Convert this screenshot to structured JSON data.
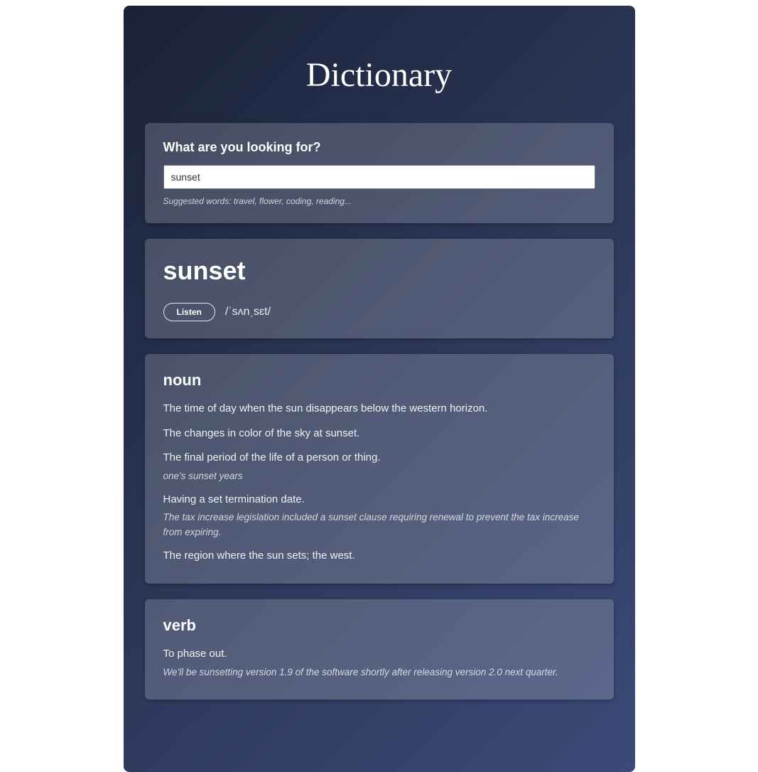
{
  "title": "Dictionary",
  "search": {
    "label": "What are you looking for?",
    "value": "sunset",
    "suggested": "Suggested words: travel, flower, coding, reading..."
  },
  "word": {
    "text": "sunset",
    "listen_label": "Listen",
    "pronunciation": "/ˈsʌnˌsɛt/"
  },
  "entries": [
    {
      "pos": "noun",
      "definitions": [
        {
          "text": "The time of day when the sun disappears below the western horizon.",
          "example": ""
        },
        {
          "text": "The changes in color of the sky at sunset.",
          "example": ""
        },
        {
          "text": "The final period of the life of a person or thing.",
          "example": "one's sunset years"
        },
        {
          "text": "Having a set termination date.",
          "example": "The tax increase legislation included a sunset clause requiring renewal to prevent the tax increase from expiring."
        },
        {
          "text": "The region where the sun sets; the west.",
          "example": ""
        }
      ]
    },
    {
      "pos": "verb",
      "definitions": [
        {
          "text": "To phase out.",
          "example": "We'll be sunsetting version 1.9 of the software shortly after releasing version 2.0 next quarter."
        }
      ]
    }
  ]
}
